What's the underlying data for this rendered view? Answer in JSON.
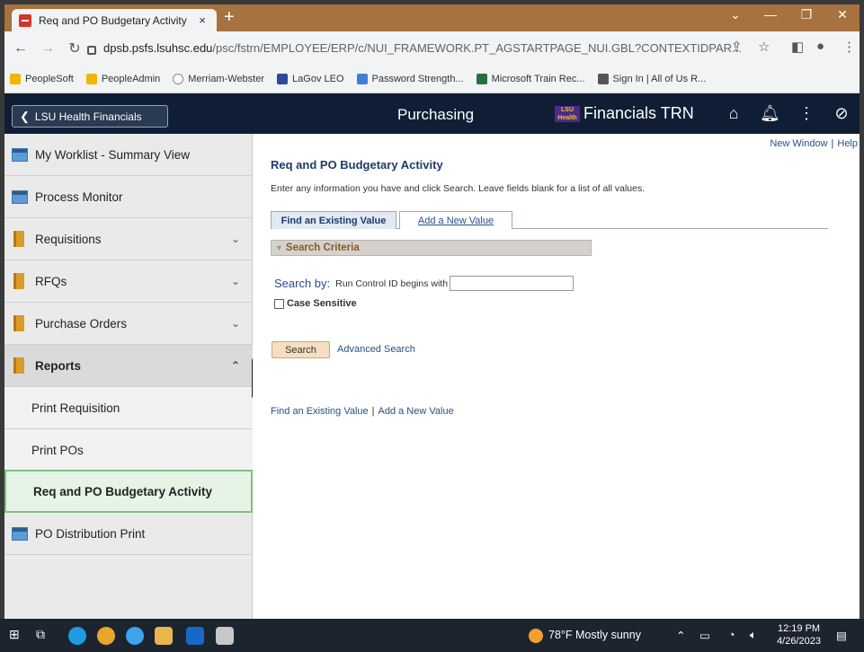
{
  "browser": {
    "tab_title": "Req and PO Budgetary Activity",
    "tab_close": "×",
    "new_tab": "+",
    "url_host": "dpsb.psfs.lsuhsc.edu",
    "url_path": "/psc/fstrn/EMPLOYEE/ERP/c/NUI_FRAMEWORK.PT_AGSTARTPAGE_NUI.GBL?CONTEXTIDPAR...",
    "bookmarks": [
      {
        "label": "PeopleSoft",
        "color": "#f2b600"
      },
      {
        "label": "PeopleAdmin",
        "color": "#f2b600"
      },
      {
        "label": "Merriam-Webster",
        "color": "#ffffff"
      },
      {
        "label": "LaGov LEO",
        "color": "#2b4a9a"
      },
      {
        "label": "Password Strength...",
        "color": "#3f7fd8"
      },
      {
        "label": "Microsoft Train Rec...",
        "color": "#2a6e3f"
      },
      {
        "label": "Sign In | All of Us R...",
        "color": "#555555"
      }
    ]
  },
  "header": {
    "back_label": "LSU Health Financials",
    "title": "Purchasing",
    "brand": "Financials TRN",
    "logo_text": "LSU Health"
  },
  "sidebar": {
    "items": [
      {
        "label": "My Worklist - Summary View"
      },
      {
        "label": "Process Monitor"
      },
      {
        "label": "Requisitions"
      },
      {
        "label": "RFQs"
      },
      {
        "label": "Purchase Orders"
      },
      {
        "label": "Reports"
      },
      {
        "label": "Print Requisition"
      },
      {
        "label": "Print POs"
      },
      {
        "label": "Req and PO Budgetary Activity"
      },
      {
        "label": "PO Distribution Print"
      }
    ]
  },
  "content": {
    "new_window": "New Window",
    "help": "Help",
    "page_title": "Req and PO Budgetary Activity",
    "instructions": "Enter any information you have and click Search. Leave fields blank for a list of all values.",
    "tab_find": "Find an Existing Value",
    "tab_add": "Add a New Value",
    "search_criteria": "Search Criteria",
    "search_by": "Search by:",
    "field_label": "Run Control ID begins with",
    "field_value": "",
    "case_sensitive": "Case Sensitive",
    "search_button": "Search",
    "advanced_search": "Advanced Search",
    "bottom_find": "Find an Existing Value",
    "bottom_add": "Add a New Value"
  },
  "taskbar": {
    "weather": "78°F  Mostly sunny",
    "time": "12:19 PM",
    "date": "4/26/2023"
  }
}
